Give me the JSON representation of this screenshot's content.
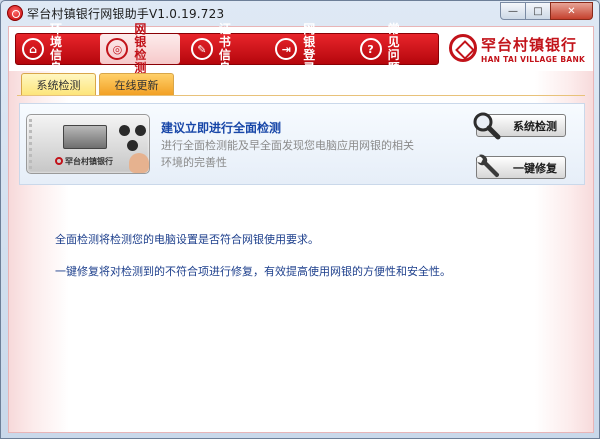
{
  "window": {
    "title": "罕台村镇银行网银助手V1.0.19.723",
    "controls": {
      "minimize": "—",
      "maximize": "□",
      "close": "✕"
    }
  },
  "nav": [
    {
      "label": "环境信息",
      "icon": "home-icon",
      "glyph": "⌂"
    },
    {
      "label": "网银检测",
      "icon": "stethoscope-icon",
      "glyph": "◎"
    },
    {
      "label": "证书信息",
      "icon": "certificate-icon",
      "glyph": "✎"
    },
    {
      "label": "网银登录",
      "icon": "login-icon",
      "glyph": "⇥"
    },
    {
      "label": "常见问题",
      "icon": "question-icon",
      "glyph": "?"
    }
  ],
  "bank": {
    "name": "罕台村镇银行",
    "english": "HAN TAI VILLAGE BANK"
  },
  "tabs": [
    {
      "label": "系统检测",
      "active": true
    },
    {
      "label": "在线更新",
      "active": false
    }
  ],
  "panel": {
    "device_brand": "罕台村镇银行",
    "title": "建议立即进行全面检测",
    "description": "进行全面检测能及早全面发现您电脑应用网银的相关环境的完善性",
    "detect_button": "系统检测",
    "repair_button": "一键修复"
  },
  "info": {
    "line1": "全面检测将检测您的电脑设置是否符合网银使用要求。",
    "line2": "一键修复将对检测到的不符合项进行修复，有效提高使用网银的方便性和安全性。"
  },
  "colors": {
    "brand_red": "#c2131a",
    "link_blue": "#1746a8",
    "tab_active": "#fde57a",
    "tab_inactive": "#f2a024"
  }
}
